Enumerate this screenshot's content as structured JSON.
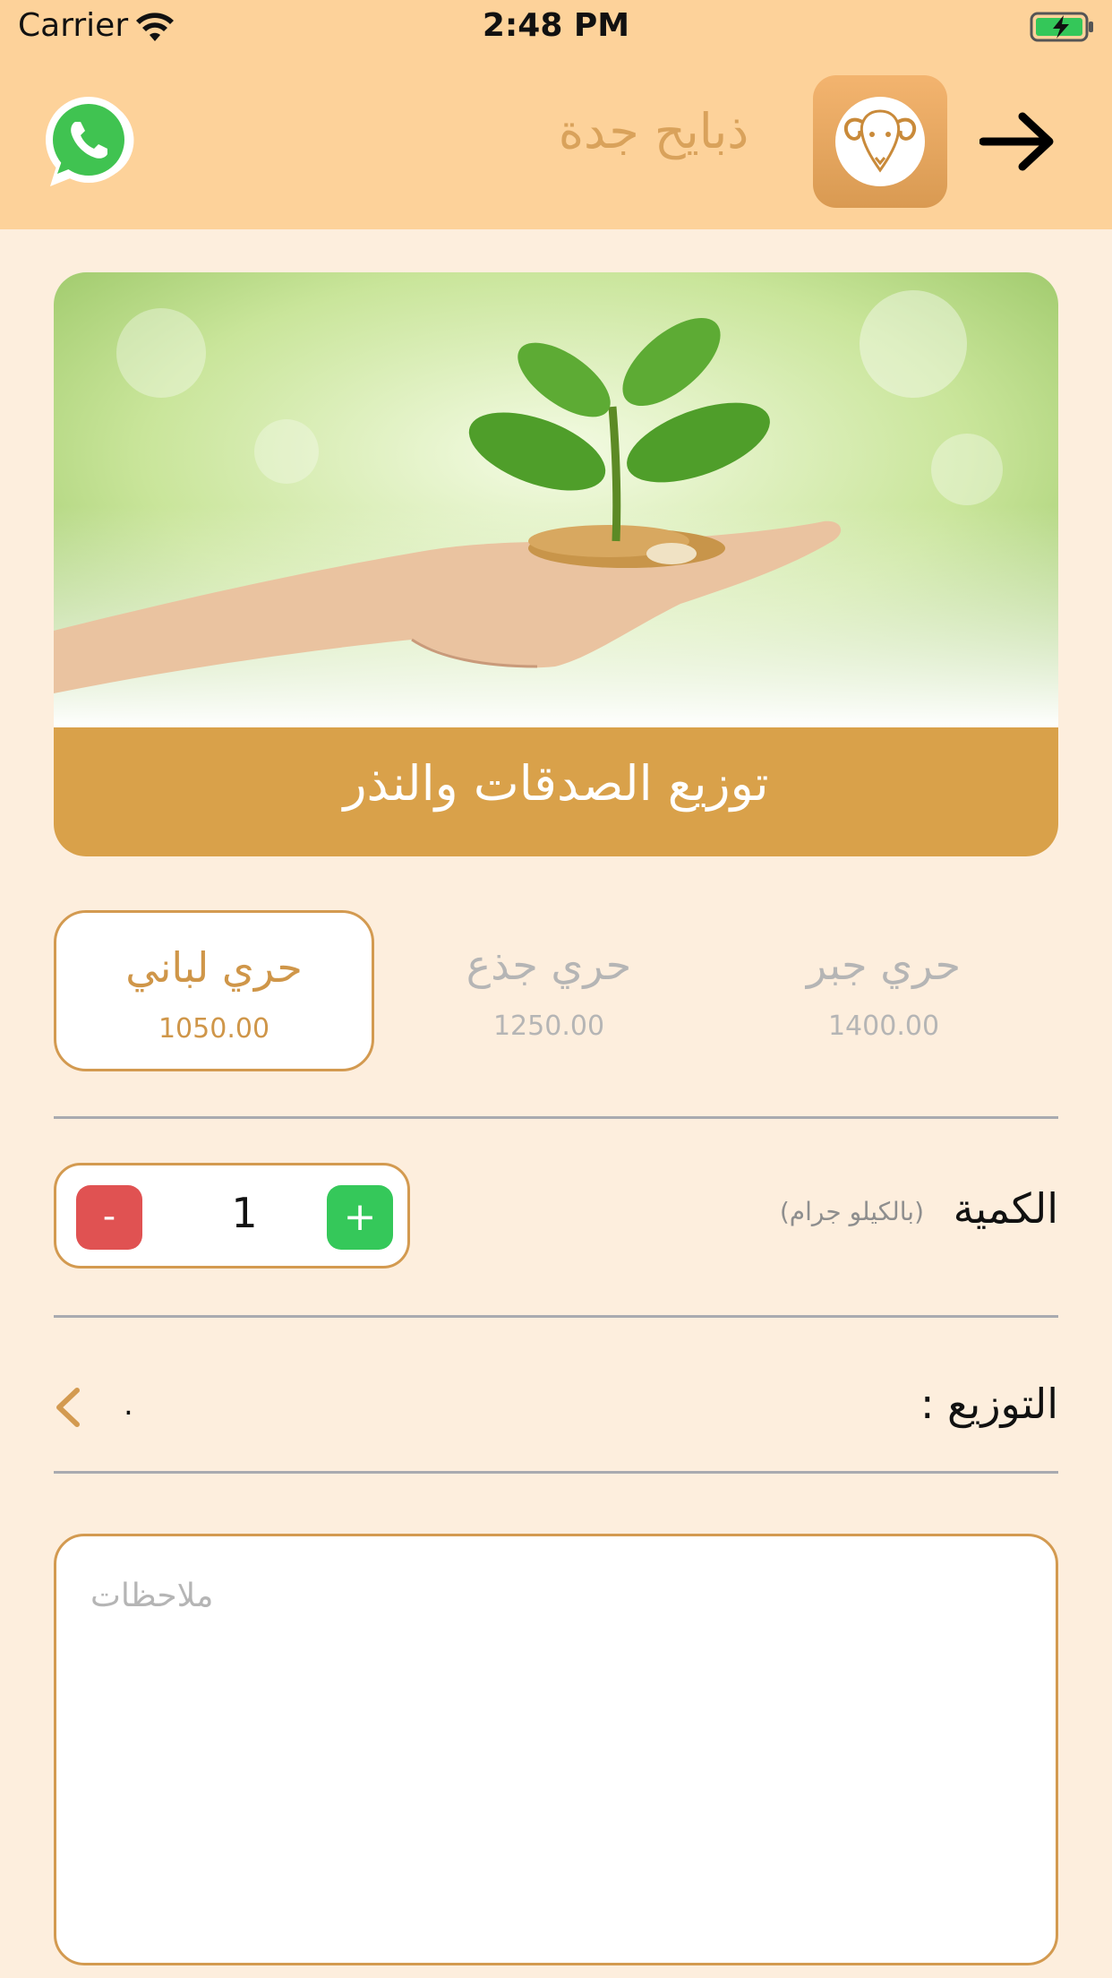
{
  "status_bar": {
    "carrier": "Carrier",
    "time": "2:48 PM"
  },
  "nav": {
    "title": "ذبايح جدة"
  },
  "banner": {
    "caption": "توزيع الصدقات والنذر"
  },
  "options": [
    {
      "name": "حري لباني",
      "price": "1050.00",
      "selected": true
    },
    {
      "name": "حري جذع",
      "price": "1250.00",
      "selected": false
    },
    {
      "name": "حري جبر",
      "price": "1400.00",
      "selected": false
    }
  ],
  "quantity": {
    "label": "الكمية",
    "unit": "(بالكيلو جرام)",
    "value": "1",
    "minus": "-",
    "plus": "+"
  },
  "distribution": {
    "label": "التوزيع :",
    "value": "."
  },
  "notes": {
    "placeholder": "ملاحظات"
  },
  "colors": {
    "header": "#fdd29a",
    "background": "#fdeedd",
    "accent": "#d9a14a",
    "minus": "#e05252",
    "plus": "#35c85a"
  }
}
